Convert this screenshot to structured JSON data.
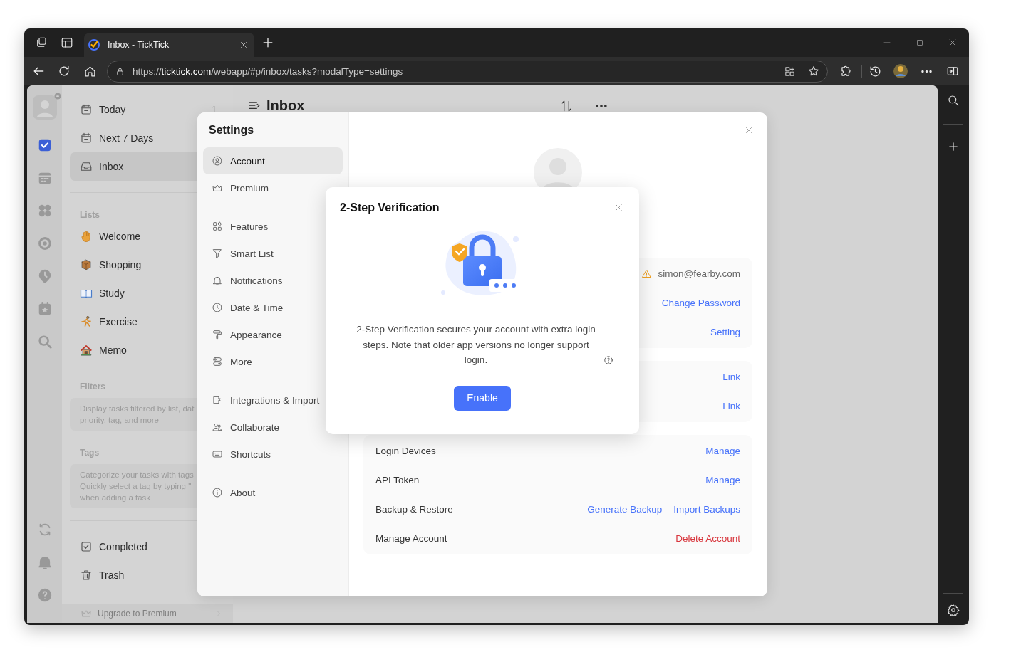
{
  "browser": {
    "tab": {
      "title": "Inbox - TickTick",
      "selected": true
    },
    "address": "https://**ticktick.com**/webapp/#p/inbox/tasks?modalType=settings"
  },
  "rail": {
    "items": [
      {
        "selected": true
      },
      {
        "selected": false
      },
      {
        "selected": false
      },
      {
        "selected": false
      },
      {
        "selected": false
      },
      {
        "selected": false
      },
      {
        "selected": false
      }
    ]
  },
  "sidebar": {
    "smart_lists": [
      {
        "label": "Today",
        "count": "1",
        "selected": false
      },
      {
        "label": "Next 7 Days",
        "selected": false
      },
      {
        "label": "Inbox",
        "selected": true
      }
    ],
    "lists_heading": "Lists",
    "lists": [
      {
        "label": "Welcome"
      },
      {
        "label": "Shopping"
      },
      {
        "label": "Study"
      },
      {
        "label": "Exercise"
      },
      {
        "label": "Memo"
      }
    ],
    "filters": {
      "heading": "Filters",
      "hint_lines": [
        "Display tasks filtered by list, dat",
        "priority, tag, and more"
      ]
    },
    "tags": {
      "heading": "Tags",
      "hint_lines": [
        "Categorize your tasks with tags",
        "Quickly select a tag by typing \"",
        "when adding a task"
      ]
    },
    "footer_items": [
      {
        "label": "Completed"
      },
      {
        "label": "Trash"
      }
    ],
    "upgrade": "Upgrade to Premium"
  },
  "inbox": {
    "title": "Inbox"
  },
  "settings": {
    "title": "Settings",
    "nav_groups": [
      {
        "items": [
          {
            "label": "Account",
            "selected": true
          },
          {
            "label": "Premium",
            "selected": false
          }
        ]
      },
      {
        "items": [
          {
            "label": "Features",
            "selected": false
          },
          {
            "label": "Smart List",
            "selected": false
          },
          {
            "label": "Notifications",
            "selected": false
          },
          {
            "label": "Date & Time",
            "selected": false
          },
          {
            "label": "Appearance",
            "selected": false
          },
          {
            "label": "More",
            "selected": false
          }
        ]
      },
      {
        "items": [
          {
            "label": "Integrations & Import",
            "selected": false
          },
          {
            "label": "Collaborate",
            "selected": false
          },
          {
            "label": "Shortcuts",
            "selected": false
          }
        ]
      },
      {
        "items": [
          {
            "label": "About",
            "selected": false
          }
        ]
      }
    ],
    "account_groups": [
      {
        "rows": [
          {
            "actions": [
              {
                "kind": "email",
                "text": "simon@fearby.com"
              }
            ]
          },
          {
            "actions": [
              {
                "kind": "link",
                "text": "Change Password"
              }
            ]
          },
          {
            "actions": [
              {
                "kind": "link",
                "text": "Setting"
              }
            ]
          }
        ]
      },
      {
        "rows": [
          {
            "actions": [
              {
                "kind": "link",
                "text": "Link"
              }
            ]
          },
          {
            "actions": [
              {
                "kind": "link",
                "text": "Link"
              }
            ]
          }
        ]
      },
      {
        "rows": [
          {
            "label": "Login Devices",
            "actions": [
              {
                "kind": "link",
                "text": "Manage"
              }
            ]
          },
          {
            "label": "API Token",
            "actions": [
              {
                "kind": "link",
                "text": "Manage"
              }
            ]
          },
          {
            "label": "Backup & Restore",
            "actions": [
              {
                "kind": "link",
                "text": "Generate Backup"
              },
              {
                "kind": "link",
                "text": "Import Backups"
              }
            ]
          },
          {
            "label": "Manage Account",
            "actions": [
              {
                "kind": "danger",
                "text": "Delete Account"
              }
            ]
          }
        ]
      }
    ]
  },
  "dialog": {
    "title": "2-Step Verification",
    "text": "2-Step Verification secures your account with extra login steps. Note that older app versions no longer support login.",
    "button": "Enable"
  }
}
